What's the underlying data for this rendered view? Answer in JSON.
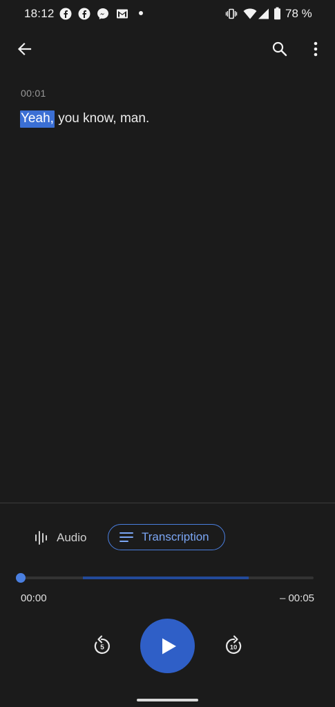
{
  "status_bar": {
    "time": "18:12",
    "battery_percent": "78 %",
    "notification_icons": [
      "facebook-icon",
      "facebook-icon",
      "messenger-icon",
      "gmail-icon"
    ],
    "system_icons": [
      "vibrate-icon",
      "wifi-icon",
      "signal-icon",
      "battery-icon"
    ]
  },
  "app_bar": {
    "back_icon": "arrow-left-icon",
    "search_icon": "search-icon",
    "menu_icon": "more-vertical-icon"
  },
  "transcript": {
    "timestamp": "00:01",
    "highlighted_word": "Yeah,",
    "rest_text": " you know, man."
  },
  "mode_toggle": {
    "audio_label": "Audio",
    "transcription_label": "Transcription",
    "selected": "Transcription"
  },
  "player": {
    "elapsed": "00:00",
    "remaining": "– 00:05",
    "rewind_seconds": "5",
    "forward_seconds": "10",
    "progress_fraction": 0.0
  },
  "colors": {
    "background": "#1b1b1b",
    "accent": "#4a7fe0",
    "highlight": "#3b6fd4",
    "play_button": "#2f5fc7"
  }
}
